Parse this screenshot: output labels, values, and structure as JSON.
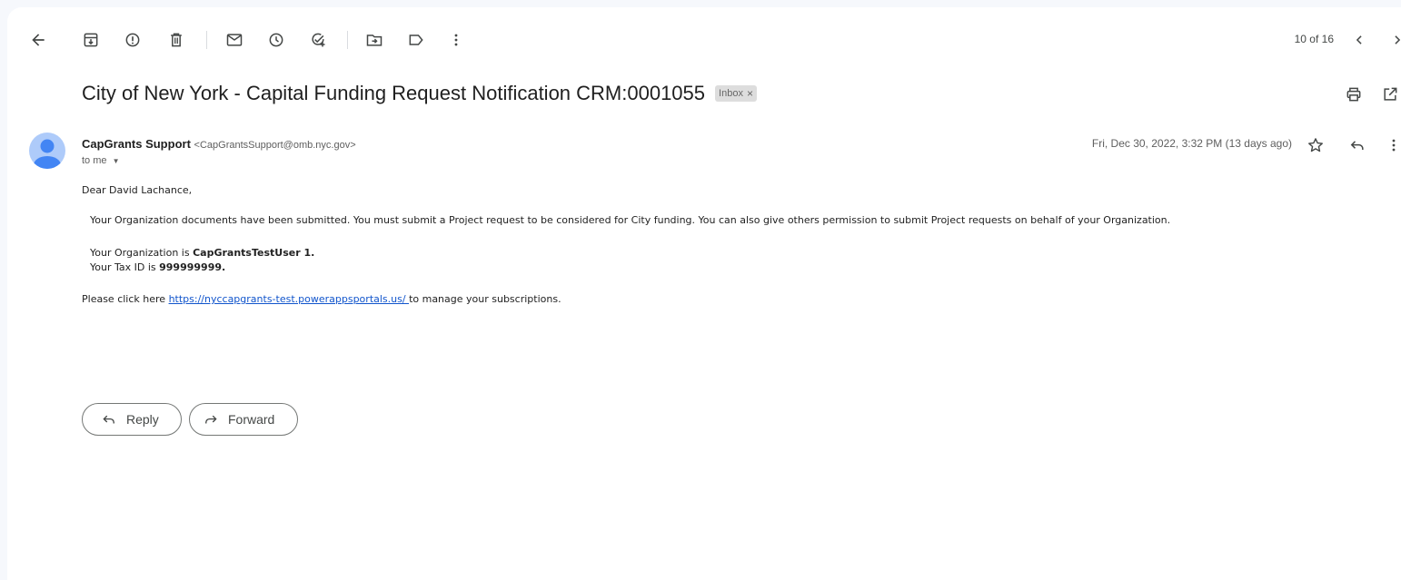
{
  "toolbar": {
    "counter": "10 of 16",
    "icons": [
      "back-arrow-icon",
      "archive-icon",
      "report-spam-icon",
      "delete-icon",
      "mark-unread-icon",
      "snooze-icon",
      "add-to-tasks-icon",
      "move-to-icon",
      "labels-icon",
      "more-vertical-icon",
      "newer-chevron-left-icon",
      "older-chevron-right-icon"
    ]
  },
  "email": {
    "subject": "City of New York - Capital Funding Request Notification CRM:0001055",
    "label": "Inbox",
    "label_close": "×",
    "sender_name": "CapGrants Support",
    "sender_email": "<CapGrantsSupport@omb.nyc.gov>",
    "recipient": "to me",
    "date": "Fri, Dec 30, 2022, 3:32 PM (13 days ago)",
    "body": {
      "greeting": "Dear David Lachance,",
      "paragraph1": "Your Organization documents have been submitted. You must submit a Project request to be considered for City funding. You can also give others permission to submit Project requests on behalf of your Organization.",
      "org_prefix": "Your Organization is ",
      "org_name": "CapGrantsTestUser 1.",
      "tax_prefix": "Your Tax ID is ",
      "tax_id": "999999999.",
      "click_prefix": "Please click here ",
      "link": " https://nyccapgrants-test.powerappsportals.us/ ",
      "click_suffix": " to manage your subscriptions."
    }
  },
  "actions": {
    "reply_label": "Reply",
    "forward_label": "Forward"
  },
  "colors": {
    "link": "#1155cc",
    "avatar": "#aecbfa",
    "avatar_figure": "#4285f4"
  }
}
